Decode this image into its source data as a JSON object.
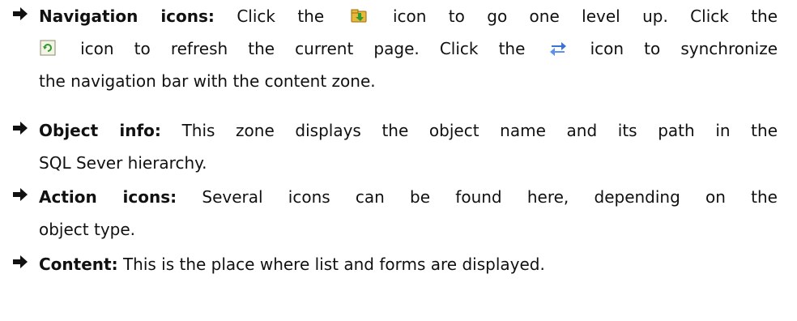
{
  "items": [
    {
      "term": "Navigation icons:",
      "line1_a": "Click the",
      "icon_up": "folder-up-icon",
      "line1_b": "icon to go one level up. Click the",
      "icon_refresh": "refresh-icon",
      "line2_b": "icon to refresh the current page. Click the",
      "icon_sync": "synchronize-icon",
      "line2_c": "icon to synchronize",
      "line3": "the navigation bar with the content zone."
    },
    {
      "term": "Object info:",
      "line1": "This zone displays the object name and its path in the",
      "line2": "SQL Sever hierarchy."
    },
    {
      "term": "Action icons:",
      "line1": "Several icons can be found here, depending on the",
      "line2": "object type."
    },
    {
      "term": "Content:",
      "line1": "This is the place where list and forms are displayed."
    }
  ],
  "bullet_icon": "right-arrow-icon",
  "colors": {
    "text": "#111111",
    "bullet": "#111111"
  }
}
